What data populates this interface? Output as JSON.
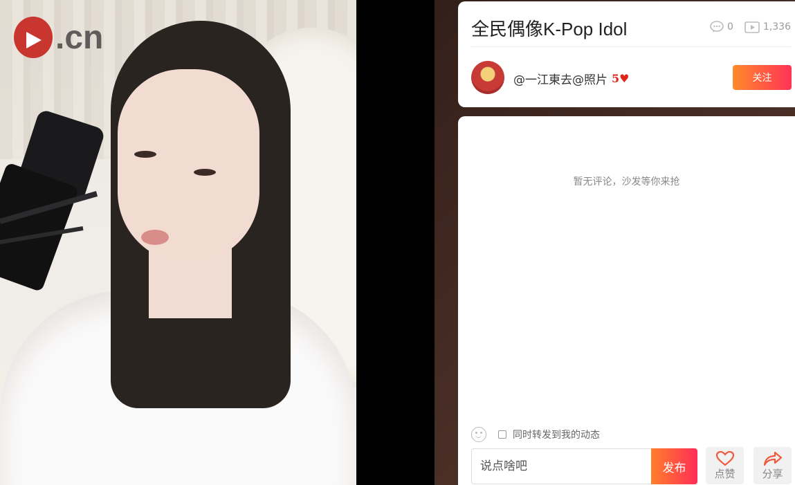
{
  "video": {
    "logo_text": ".cn"
  },
  "info": {
    "title": "全民偶像K-Pop Idol",
    "comment_count": "0",
    "view_count": "1,336",
    "username": "@一江東去@照片",
    "level_badge": "5",
    "follow_label": "关注"
  },
  "comments": {
    "empty_message": "暂无评论，沙发等你来抢",
    "repost_label": "同时转发到我的动态",
    "input_placeholder": "说点啥吧",
    "publish_label": "发布",
    "like_label": "点赞",
    "share_label": "分享"
  },
  "colors": {
    "accent_start": "#ff8a2b",
    "accent_end": "#ff3356"
  }
}
